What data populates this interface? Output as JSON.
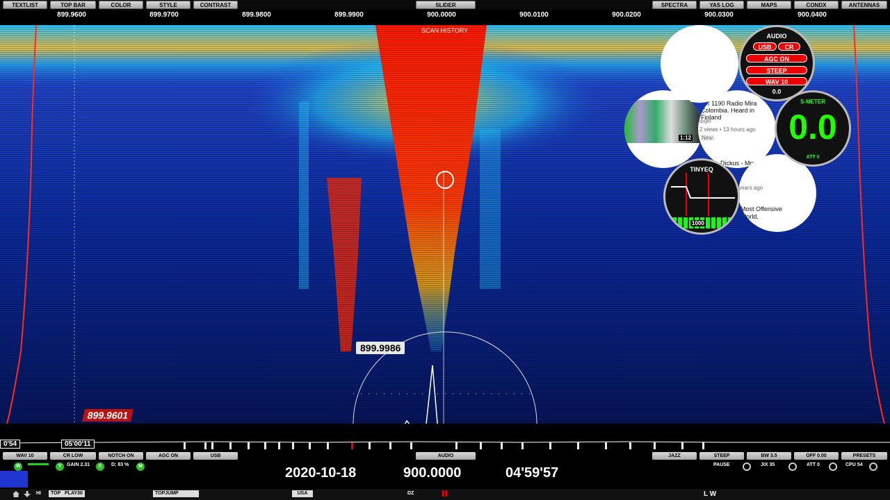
{
  "top_buttons": {
    "textlist": "TEXTLIST",
    "top_bar": "TOP BAR",
    "color": "COLOR",
    "style": "STYLE",
    "contrast": "CONTRAST",
    "slider": "SLIDER",
    "spectra": "SPECTRA",
    "yas_log": "YAS LOG",
    "maps": "MAPS",
    "condx": "CONDX",
    "antennas": "ANTENNAS"
  },
  "freq_scale": [
    "899.9600",
    "899.9700",
    "899.9800",
    "899.9900",
    "900.0000",
    "900.0100",
    "900.0200",
    "900.0300",
    "900.0400"
  ],
  "waterfall": {
    "scan_history": "SCAN HISTORY",
    "cursor_readout": "899.9986",
    "left_marker": "899.9601"
  },
  "timeline": {
    "left_time": "0'54",
    "mid_time": "05'00'11"
  },
  "bottom_buttons": {
    "wav": "WAV 10",
    "cr_low": "CR LOW",
    "notch": "NOTCH ON",
    "agc": "AGC ON",
    "mode": "USB",
    "audio": "AUDIO",
    "jazz": "JAZZ",
    "steep": "STEEP",
    "bw": "BW 3.5",
    "off": "OFF 0.00",
    "presets": "PRESETS"
  },
  "bottom_info": {
    "gain": "GAIN 2.31",
    "d": "D: 83 %",
    "pause": "PAUSE",
    "jix": "JIX 35",
    "att": "ATT 0",
    "cpu": "CPU 54",
    "badge_w": "W",
    "badge_y": "Y",
    "badge_s": "S",
    "badge_m": "M"
  },
  "status_line": {
    "date": "2020-10-18",
    "frequency": "900.0000",
    "time": "04'59'57"
  },
  "last_row": {
    "hi": "HI",
    "top": "TOP",
    "play": "PLAY30",
    "topjump": "TOPJUMP",
    "country": "USA",
    "dz": "DZ",
    "lw": "L W"
  },
  "audio_panel": {
    "title": "AUDIO",
    "usb": "USB",
    "cr": "CR",
    "agc": "AGC ON",
    "steep": "STEEP",
    "wav": "WAV 10",
    "value": "0.0"
  },
  "smeter": {
    "title": "S-METER",
    "value": "0.0",
    "att": "ATT 0"
  },
  "tinyeq": {
    "title": "TINYEQ",
    "value": "1000"
  },
  "youtube": {
    "duration": "1:12",
    "title1": "DX 1190 Radio Mira Colombia. Heard in Finland",
    "channel": "dxjln",
    "meta": "2 views • 13 hours ago",
    "badge": "New",
    "title2": "Dickus - Monty Python,",
    "meta2": "years ago",
    "title3": "Most Offensive World."
  },
  "colors": {
    "waterfall_bg": "#0a1a6e",
    "signal_hot": "#ff1a00",
    "button_face": "#c8c8c8",
    "accent_red": "#e00000",
    "meter_green": "#22ff00"
  }
}
